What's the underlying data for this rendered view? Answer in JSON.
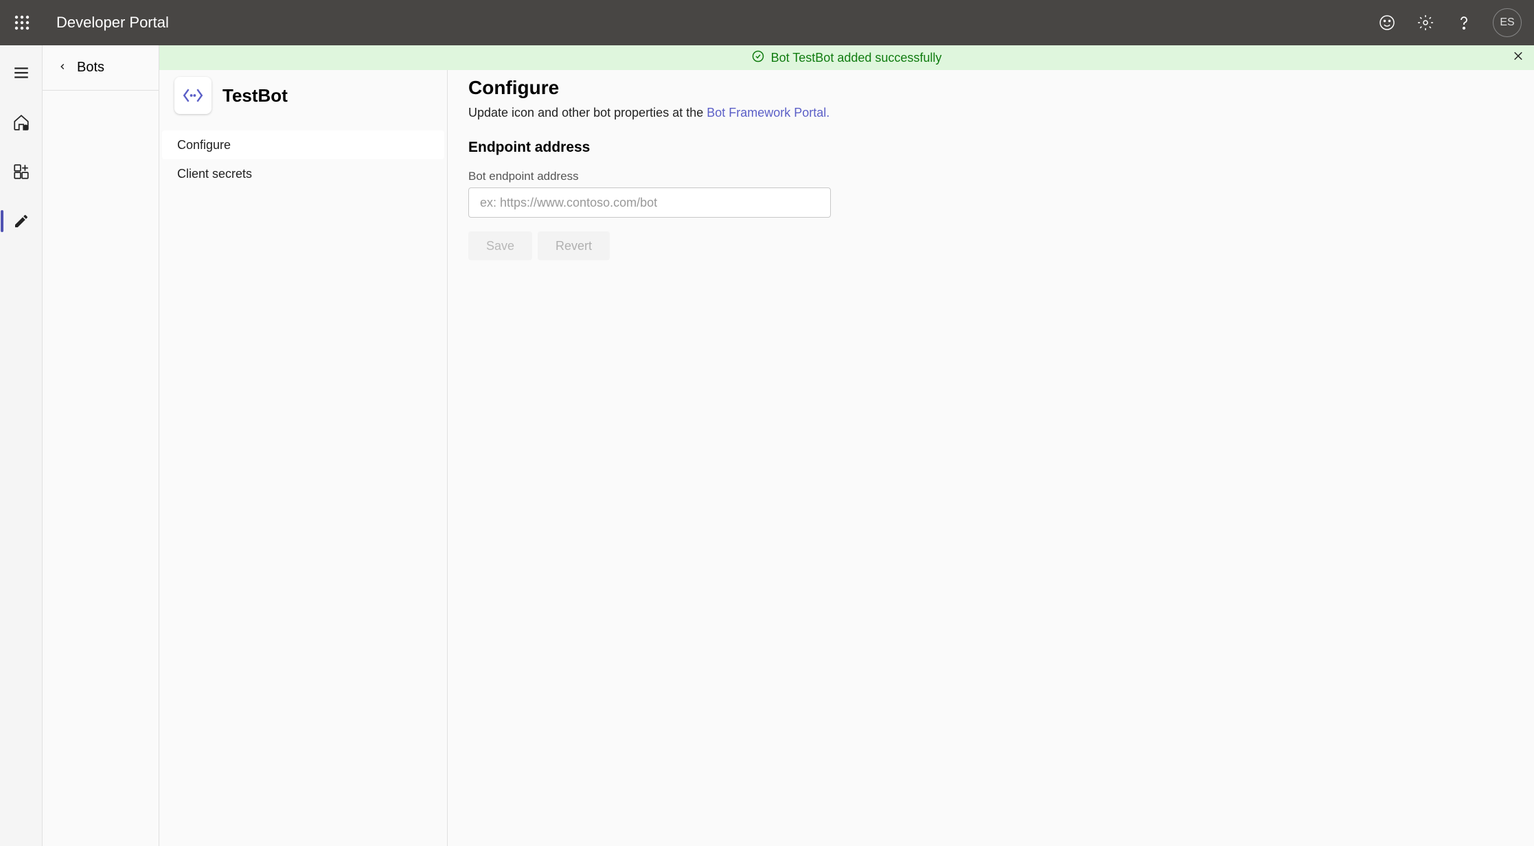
{
  "header": {
    "title": "Developer Portal",
    "avatar_initials": "ES"
  },
  "breadcrumb": {
    "label": "Bots"
  },
  "notification": {
    "text": "Bot TestBot added successfully"
  },
  "bot": {
    "name": "TestBot"
  },
  "side_nav": {
    "configure": "Configure",
    "client_secrets": "Client secrets"
  },
  "configure": {
    "heading": "Configure",
    "subtext_prefix": "Update icon and other bot properties at the ",
    "subtext_link": "Bot Framework Portal.",
    "endpoint_heading": "Endpoint address",
    "endpoint_label": "Bot endpoint address",
    "endpoint_placeholder": "ex: https://www.contoso.com/bot",
    "save_label": "Save",
    "revert_label": "Revert"
  }
}
